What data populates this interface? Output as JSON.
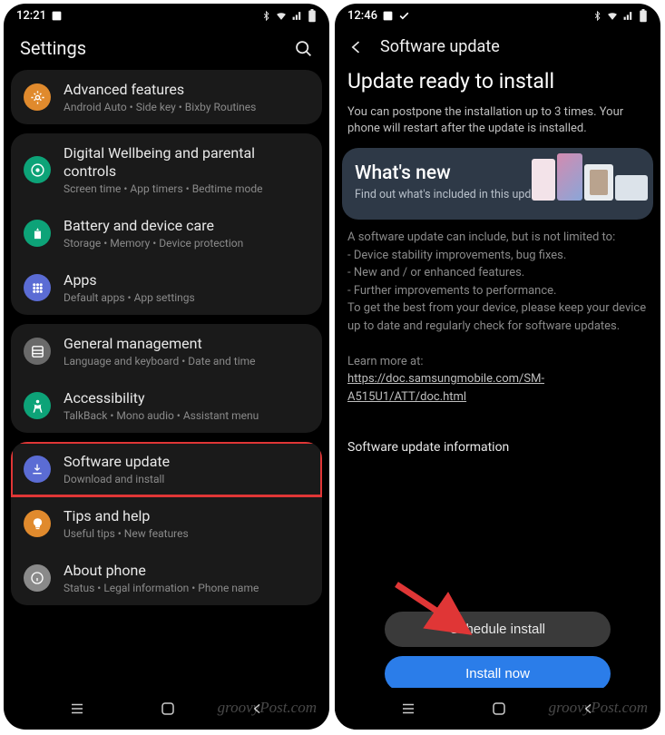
{
  "left": {
    "status_time": "12:21",
    "header_title": "Settings",
    "items": [
      {
        "title": "Advanced features",
        "sub": "Android Auto • Side key • Bixby Routines",
        "icon_bg": "#e08a2d",
        "icon": "gear",
        "name": "advanced-features"
      },
      {
        "title": "Digital Wellbeing and parental controls",
        "sub": "Screen time • App timers • Bedtime mode",
        "icon_bg": "#0da378",
        "icon": "wellbeing",
        "name": "digital-wellbeing"
      },
      {
        "title": "Battery and device care",
        "sub": "Storage • Memory • Device protection",
        "icon_bg": "#0da378",
        "icon": "battery-care",
        "name": "device-care"
      },
      {
        "title": "Apps",
        "sub": "Default apps • App settings",
        "icon_bg": "#5b6cd4",
        "icon": "apps",
        "name": "apps"
      },
      {
        "title": "General management",
        "sub": "Language and keyboard • Date and time",
        "icon_bg": "#6a6a6a",
        "icon": "general",
        "name": "general-management"
      },
      {
        "title": "Accessibility",
        "sub": "TalkBack • Mono audio • Assistant menu",
        "icon_bg": "#0da378",
        "icon": "accessibility",
        "name": "accessibility"
      },
      {
        "title": "Software update",
        "sub": "Download and install",
        "icon_bg": "#5b6cd4",
        "icon": "update",
        "name": "software-update",
        "highlight": true
      },
      {
        "title": "Tips and help",
        "sub": "Useful tips • New features",
        "icon_bg": "#e08a2d",
        "icon": "tips",
        "name": "tips-help"
      },
      {
        "title": "About phone",
        "sub": "Status • Legal information • Phone name",
        "icon_bg": "#8a8a8a",
        "icon": "about",
        "name": "about-phone"
      }
    ]
  },
  "right": {
    "status_time": "12:46",
    "header_title": "Software update",
    "big_title": "Update ready to install",
    "desc": "You can postpone the installation up to 3 times. Your phone will restart after the update is installed.",
    "whats_new_title": "What's new",
    "whats_new_sub": "Find out what's included in this update.",
    "details_intro": "A software update can include, but is not limited to:",
    "details_bullets": [
      "Device stability improvements, bug fixes.",
      "New and / or enhanced features.",
      "Further improvements to performance."
    ],
    "details_outro": "To get the best from your device, please keep your device up to date and regularly check for software updates.",
    "learn_label": "Learn more at:",
    "learn_link": "https://doc.samsungmobile.com/SM-A515U1/ATT/doc.html",
    "info_heading": "Software update information",
    "schedule_label": "Schedule install",
    "install_label": "Install now"
  },
  "watermark": "groovyPost.com"
}
